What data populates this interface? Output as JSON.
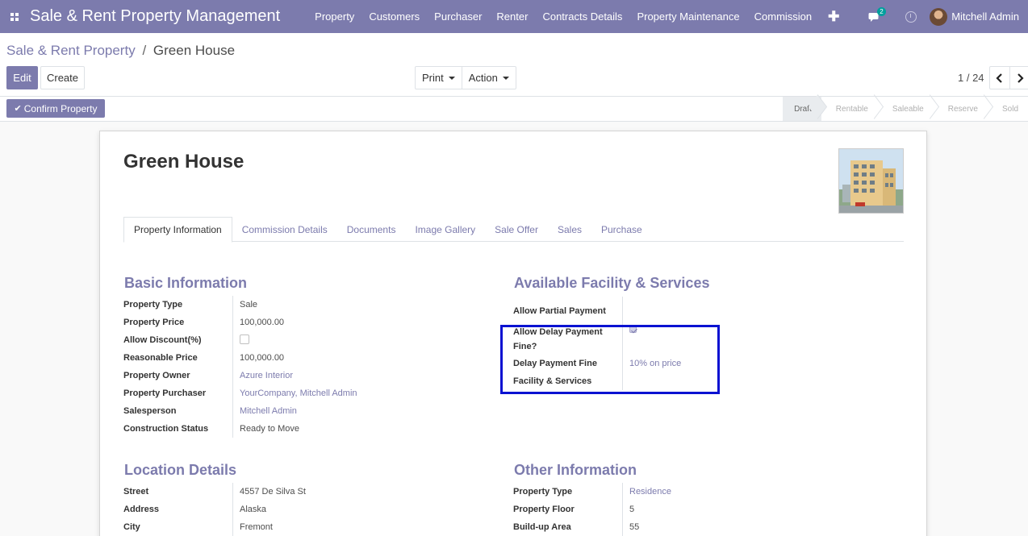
{
  "navbar": {
    "app_title": "Sale & Rent Property Management",
    "menu": [
      "Property",
      "Customers",
      "Purchaser",
      "Renter",
      "Contracts Details",
      "Property Maintenance",
      "Commission"
    ],
    "plus": "✚",
    "chat_badge": "2",
    "user_name": "Mitchell Admin"
  },
  "breadcrumb": {
    "parent": "Sale & Rent Property",
    "separator": "/",
    "current": "Green House"
  },
  "toolbar": {
    "edit_label": "Edit",
    "create_label": "Create",
    "print_label": "Print",
    "action_label": "Action"
  },
  "pager": {
    "value": "1 / 24",
    "prev": "‹",
    "next": "›"
  },
  "statusbar": {
    "confirm_label": "Confirm Property",
    "stages": [
      "Draft",
      "Rentable",
      "Saleable",
      "Reserve",
      "Sold"
    ],
    "active_stage": "Draft"
  },
  "record": {
    "title": "Green House",
    "tabs": [
      "Property Information",
      "Commission Details",
      "Documents",
      "Image Gallery",
      "Sale Offer",
      "Sales",
      "Purchase"
    ],
    "basic_info": {
      "title": "Basic Information",
      "fields": [
        {
          "label": "Property Type",
          "value": "Sale"
        },
        {
          "label": "Property Price",
          "value": "100,000.00"
        },
        {
          "label": "Allow Discount(%)",
          "value": ""
        },
        {
          "label": "Reasonable Price",
          "value": "100,000.00"
        },
        {
          "label": "Property Owner",
          "value": "Azure Interior"
        },
        {
          "label": "Property Purchaser",
          "value": "YourCompany, Mitchell Admin"
        },
        {
          "label": "Salesperson",
          "value": "Mitchell Admin"
        },
        {
          "label": "Construction Status",
          "value": "Ready to Move"
        }
      ]
    },
    "facility": {
      "title": "Available Facility & Services",
      "fields": [
        {
          "label": "Allow Partial Payment",
          "value": ""
        },
        {
          "label": "Allow Delay Payment Fine?",
          "value": ""
        },
        {
          "label": "Delay Payment Fine",
          "value": "10% on price"
        },
        {
          "label": "Facility & Services",
          "value": ""
        }
      ]
    },
    "location": {
      "title": "Location Details",
      "fields": [
        {
          "label": "Street",
          "value": "4557 De Silva St"
        },
        {
          "label": "Address",
          "value": "Alaska"
        },
        {
          "label": "City",
          "value": "Fremont"
        }
      ]
    },
    "other": {
      "title": "Other Information",
      "fields": [
        {
          "label": "Property Type",
          "value": "Residence"
        },
        {
          "label": "Property Floor",
          "value": "5"
        },
        {
          "label": "Build-up Area",
          "value": "55"
        }
      ]
    }
  },
  "colors": {
    "brand": "#7c7bad",
    "highlight": "#0b12d1"
  }
}
